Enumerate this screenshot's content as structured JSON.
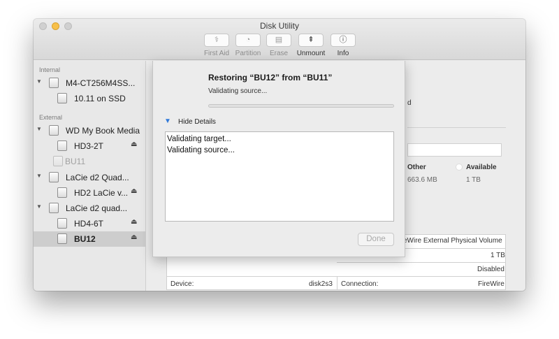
{
  "window": {
    "title": "Disk Utility"
  },
  "toolbar": {
    "items": [
      {
        "label": "First Aid",
        "icon": "stethoscope-icon",
        "glyph": "⚕"
      },
      {
        "label": "Partition",
        "icon": "partition-icon",
        "glyph": "◔"
      },
      {
        "label": "Erase",
        "icon": "erase-icon",
        "glyph": "▤"
      },
      {
        "label": "Unmount",
        "icon": "unmount-icon",
        "glyph": "⇞"
      },
      {
        "label": "Info",
        "icon": "info-icon",
        "glyph": "ⓘ"
      }
    ]
  },
  "sidebar": {
    "internal_header": "Internal",
    "external_header": "External",
    "items": [
      {
        "label": "M4-CT256M4SS..."
      },
      {
        "label": "10.11 on SSD"
      },
      {
        "label": "WD My Book Media"
      },
      {
        "label": "HD3-2T"
      },
      {
        "label": "BU11"
      },
      {
        "label": "LaCie d2 Quad..."
      },
      {
        "label": "HD2 LaCie v..."
      },
      {
        "label": "LaCie d2 quad..."
      },
      {
        "label": "HD4-6T"
      },
      {
        "label": "BU12"
      }
    ],
    "eject_glyph": "⏏"
  },
  "background_info": {
    "partial_d": "d",
    "other_label": "Other",
    "other_value": "663.6 MB",
    "available_label": "Available",
    "available_value": "1 TB",
    "connection_type": "eWire External Physical Volume",
    "capacity": "1 TB",
    "owners": "Disabled",
    "device_label": "Device:",
    "device_value": "disk2s3",
    "connection_label": "Connection:",
    "connection_value": "FireWire"
  },
  "sheet": {
    "title": "Restoring “BU12” from “BU11”",
    "status": "Validating source...",
    "progress": 0,
    "hide_details": "Hide Details",
    "log_lines": [
      "Validating target...",
      "Validating source..."
    ],
    "done_label": "Done"
  }
}
